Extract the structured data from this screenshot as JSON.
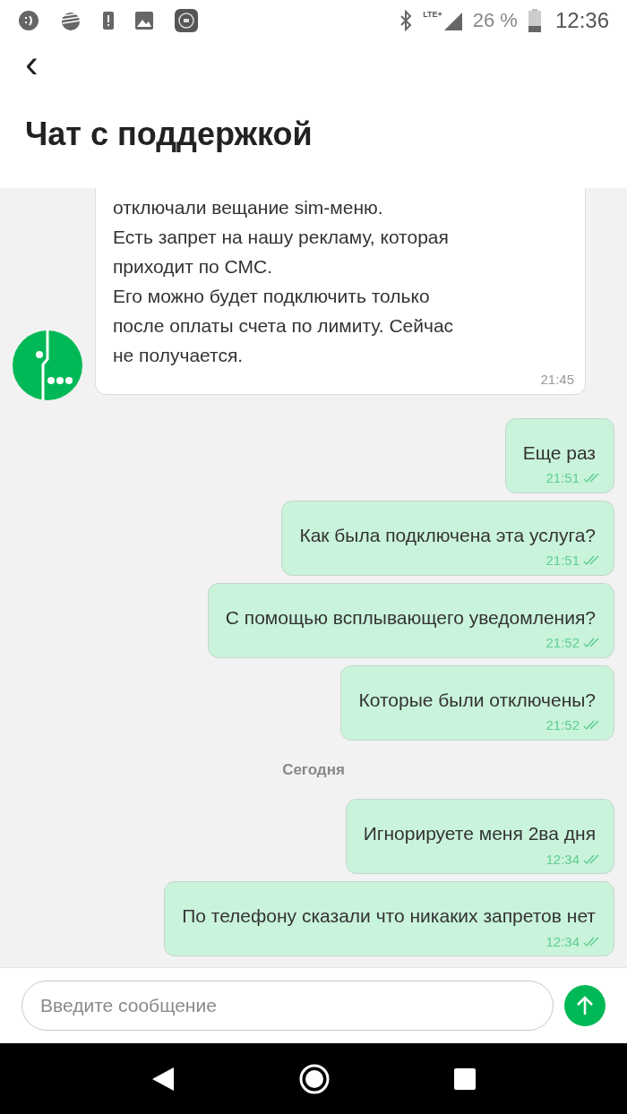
{
  "status_bar": {
    "network": "LTE+",
    "battery": "26 %",
    "time": "12:36"
  },
  "header": {
    "back": "‹",
    "title": "Чат с поддержкой"
  },
  "messages": [
    {
      "kind": "incoming",
      "text": "отключали вещание sim-меню.\nЕсть запрет на нашу рекламу, которая\nприходит по СМС.\nЕго можно будет подключить только\nпосле оплаты счета по лимиту. Сейчас\nне получается.",
      "time": "21:45"
    },
    {
      "kind": "outgoing",
      "text": "Еще раз",
      "time": "21:51",
      "read": true
    },
    {
      "kind": "outgoing",
      "text": "Как была подключена эта услуга?",
      "time": "21:51",
      "read": true
    },
    {
      "kind": "outgoing",
      "text": "С помощью всплывающего уведомления?",
      "time": "21:52",
      "read": true
    },
    {
      "kind": "outgoing",
      "text": "Которые были отключены?",
      "time": "21:52",
      "read": true
    },
    {
      "kind": "date",
      "text": "Сегодня"
    },
    {
      "kind": "outgoing",
      "text": "Игнорируете меня 2ва дня",
      "time": "12:34",
      "read": true
    },
    {
      "kind": "outgoing",
      "text": "По телефону сказали что никаких запретов нет",
      "time": "12:34",
      "read": true
    }
  ],
  "composer": {
    "placeholder": "Введите сообщение"
  }
}
